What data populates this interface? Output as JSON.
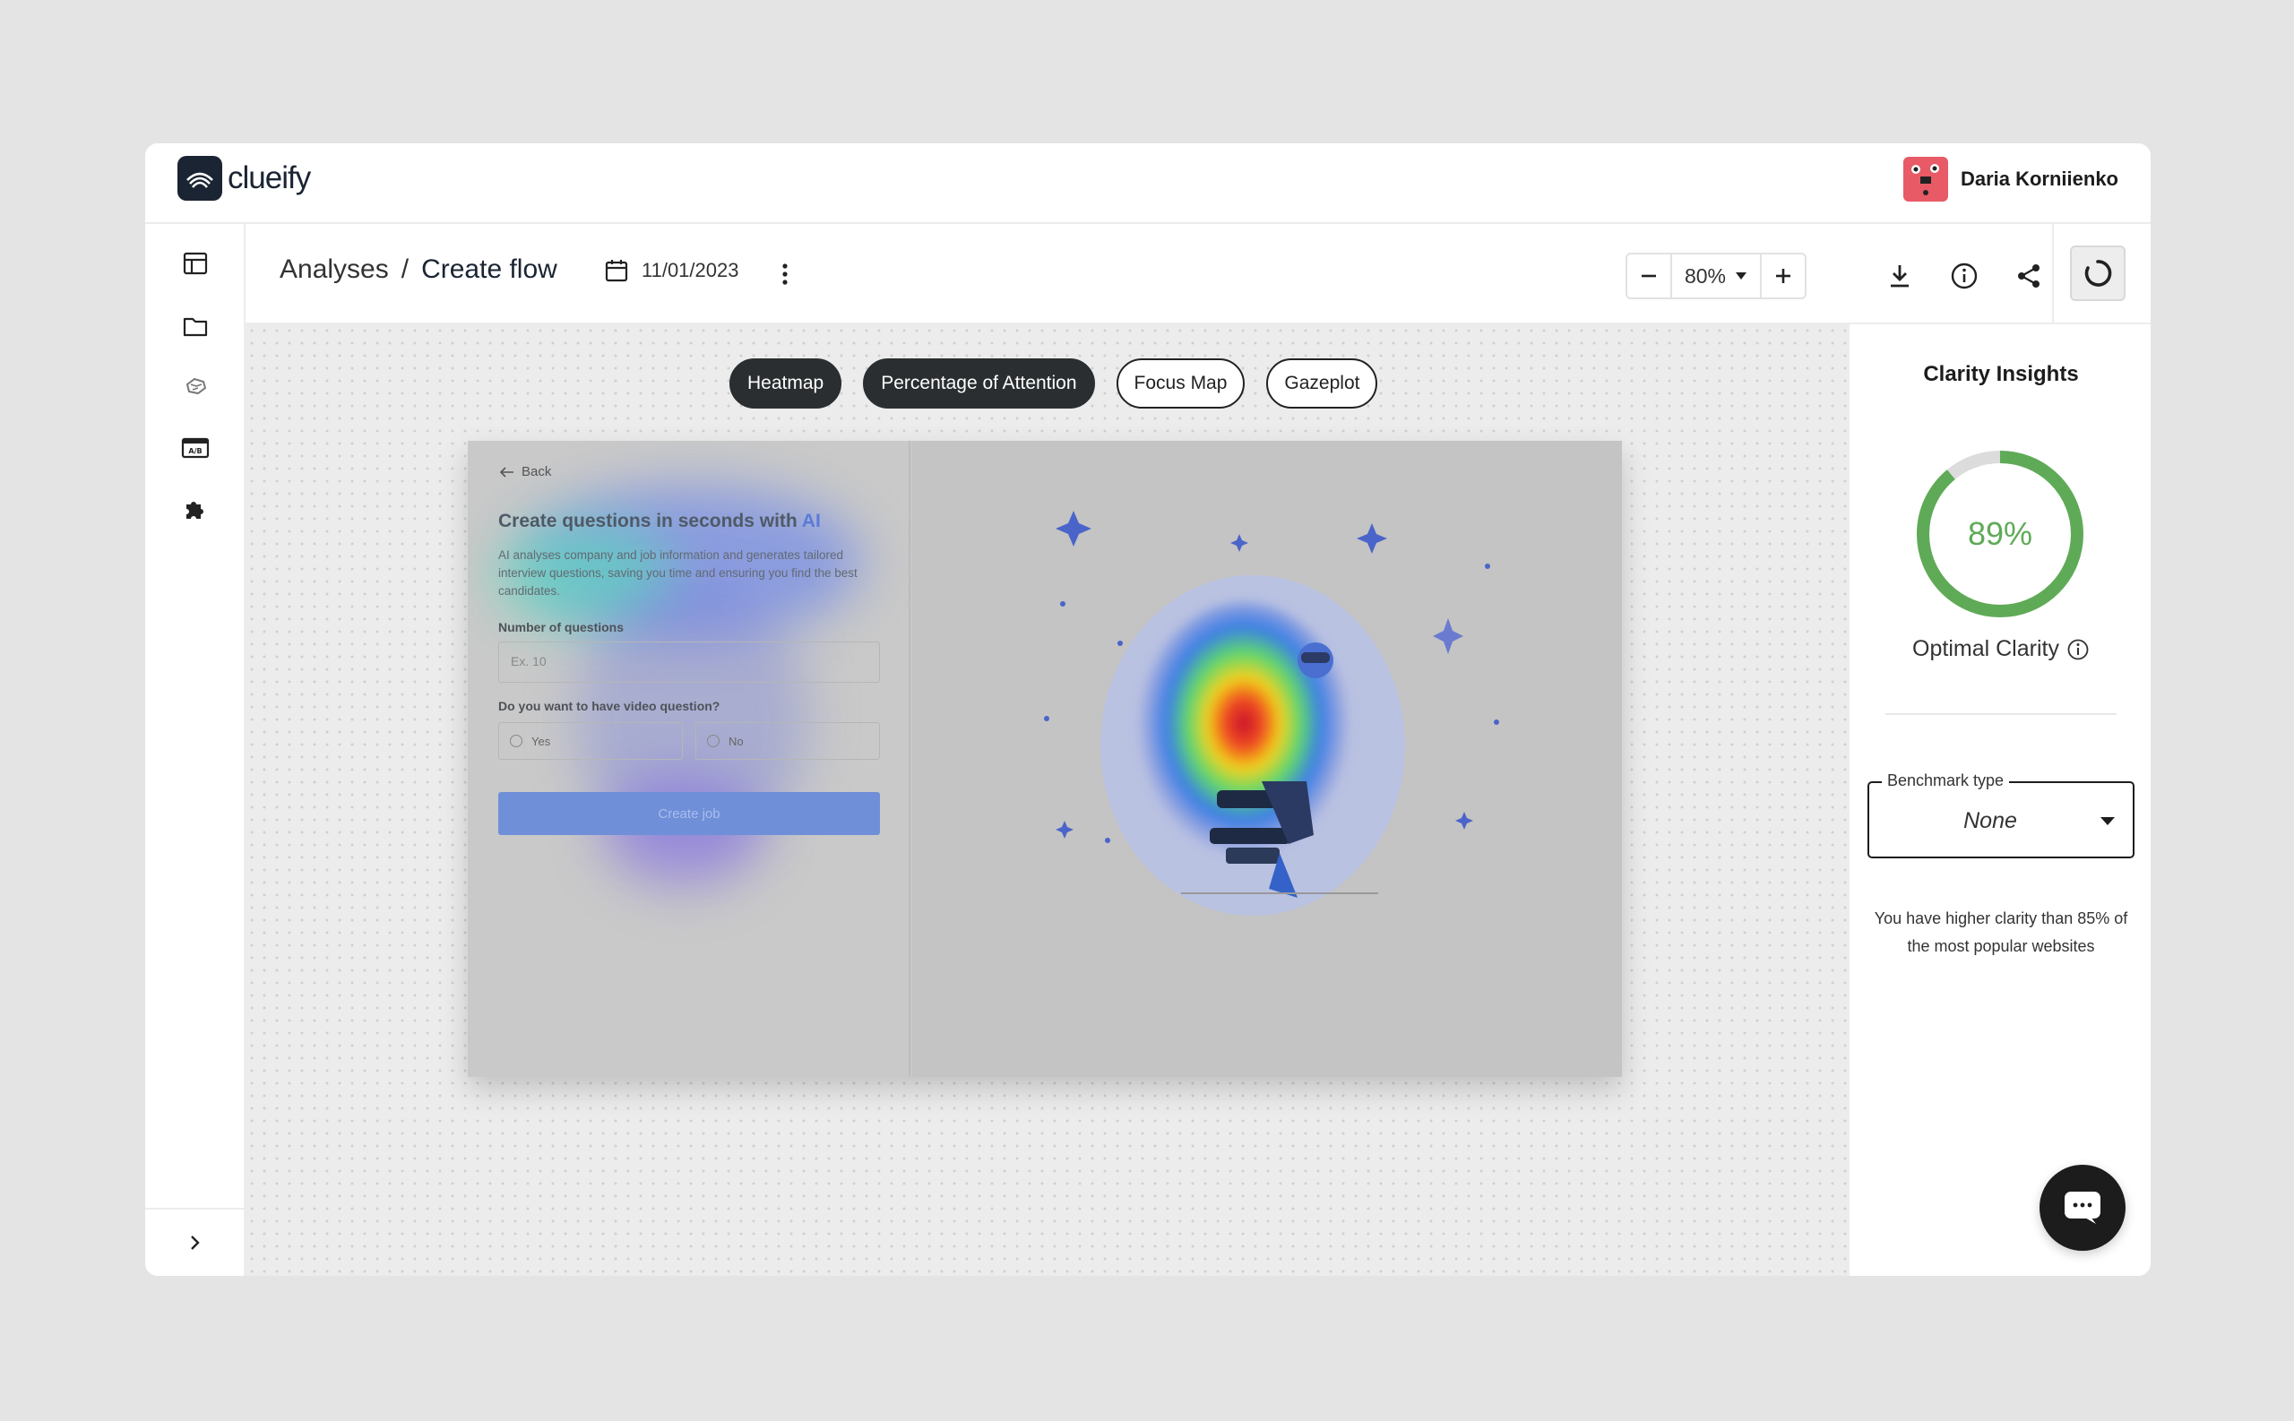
{
  "app": {
    "name": "clueify"
  },
  "user": {
    "name": "Daria Korniienko"
  },
  "header": {
    "breadcrumb_root": "Analyses",
    "breadcrumb_sep": "/",
    "breadcrumb_current": "Create flow",
    "date": "11/01/2023",
    "zoom": "80%"
  },
  "tabs": [
    {
      "label": "Heatmap",
      "active": true
    },
    {
      "label": "Percentage of Attention",
      "active": true
    },
    {
      "label": "Focus Map",
      "active": false
    },
    {
      "label": "Gazeplot",
      "active": false
    }
  ],
  "preview": {
    "back": "Back",
    "title_main": "Create questions in seconds with ",
    "title_ai": "AI",
    "description": "AI analyses company and job information and generates tailored interview questions, saving you time and ensuring you find the best candidates.",
    "questions_label": "Number of questions",
    "questions_placeholder": "Ex. 10",
    "video_label": "Do you want to have video question?",
    "yes": "Yes",
    "no": "No",
    "button": "Create job"
  },
  "insights": {
    "title": "Clarity Insights",
    "score": "89%",
    "score_value": 89,
    "status": "Optimal Clarity",
    "benchmark_label": "Benchmark type",
    "benchmark_value": "None",
    "note": "You have higher clarity than 85% of the most popular websites"
  },
  "colors": {
    "accent_green": "#5faa57",
    "dark": "#2a2e31",
    "brand": "#1a2433"
  }
}
